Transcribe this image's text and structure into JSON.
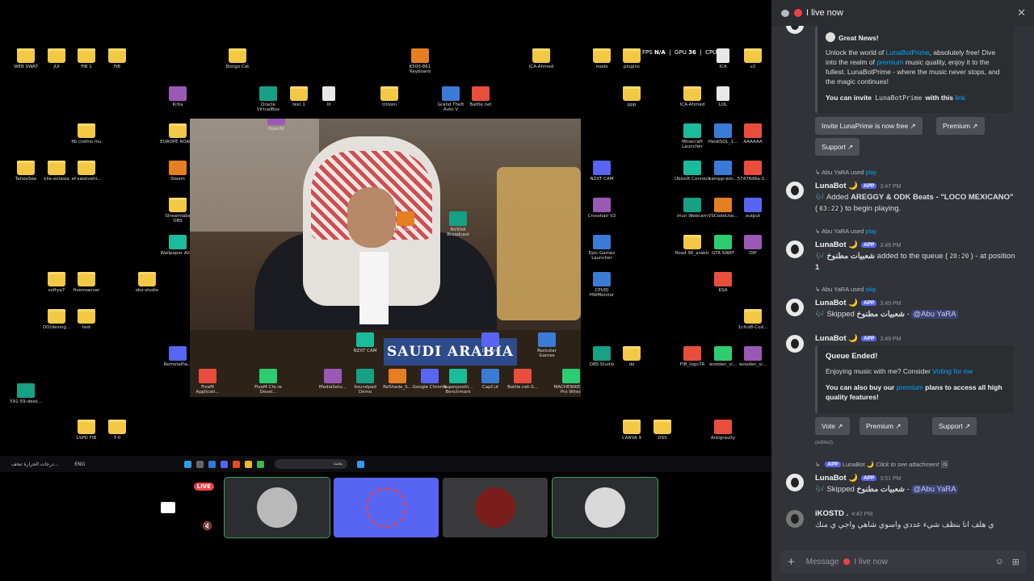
{
  "stream": {
    "overlay": {
      "fps": "FPS",
      "fps_value": "N/A",
      "gpu": "GPU",
      "gpu_value": "36",
      "cpu": "CPU"
    },
    "desktop_icons": [
      {
        "label": "WEB SWAT",
        "kind": "folder"
      },
      {
        "label": "JUI",
        "kind": "folder"
      },
      {
        "label": "FiB 1",
        "kind": "folder"
      },
      {
        "label": "FiB",
        "kind": "folder"
      },
      {
        "label": "Bongo Cat",
        "kind": "folder"
      },
      {
        "label": "K500-861 Keyboard",
        "kind": "app"
      },
      {
        "label": "ICA-Ahmed",
        "kind": "folder"
      },
      {
        "label": "mods",
        "kind": "folder"
      },
      {
        "label": "plugins",
        "kind": "folder"
      },
      {
        "label": "ICA",
        "kind": "file"
      },
      {
        "label": "v2",
        "kind": "folder"
      },
      {
        "label": "Krita",
        "kind": "app"
      },
      {
        "label": "Oracle VirtualBox",
        "kind": "app"
      },
      {
        "label": "test 1",
        "kind": "folder"
      },
      {
        "label": "lll",
        "kind": "file"
      },
      {
        "label": "citizen",
        "kind": "folder"
      },
      {
        "label": "Grand Theft Auto V",
        "kind": "app"
      },
      {
        "label": "Battle.net",
        "kind": "app"
      },
      {
        "label": "ppp",
        "kind": "folder"
      },
      {
        "label": "ICA-Ahmed",
        "kind": "folder"
      },
      {
        "label": "LOL",
        "kind": "file"
      },
      {
        "label": "fib clothis mu",
        "kind": "folder"
      },
      {
        "label": "EUROPE ROADS",
        "kind": "folder"
      },
      {
        "label": "Minecraft Launcher",
        "kind": "app"
      },
      {
        "label": "HeidiSQL_1...",
        "kind": "app"
      },
      {
        "label": "AAAAAA",
        "kind": "app"
      },
      {
        "label": "TahoeSee",
        "kind": "folder"
      },
      {
        "label": "kile-extesia",
        "kind": "folder"
      },
      {
        "label": "ef-swatvehi...",
        "kind": "folder"
      },
      {
        "label": "Steam",
        "kind": "app"
      },
      {
        "label": "NZXT CAM",
        "kind": "app"
      },
      {
        "label": "Ubisoft Connect",
        "kind": "app"
      },
      {
        "label": "xampp-win...",
        "kind": "app"
      },
      {
        "label": "57476d6a-3...",
        "kind": "app"
      },
      {
        "label": "Streamlabs OBS",
        "kind": "folder"
      },
      {
        "label": "Crosshair V2",
        "kind": "app"
      },
      {
        "label": "Iriun Webcam",
        "kind": "app"
      },
      {
        "label": "VSCodeUse...",
        "kind": "app"
      },
      {
        "label": "output",
        "kind": "app"
      },
      {
        "label": "Wallpaper Alive",
        "kind": "app"
      },
      {
        "label": "Epic Games Launcher",
        "kind": "app"
      },
      {
        "label": "Road 96_arabic",
        "kind": "folder"
      },
      {
        "label": "GTA SWAT",
        "kind": "app"
      },
      {
        "label": "OIP",
        "kind": "app"
      },
      {
        "label": "softyq7",
        "kind": "folder"
      },
      {
        "label": "fivemserver",
        "kind": "folder"
      },
      {
        "label": "obs-studio",
        "kind": "folder"
      },
      {
        "label": "Everything",
        "kind": "app"
      },
      {
        "label": "CPUID HWMonitor",
        "kind": "app"
      },
      {
        "label": "KSA",
        "kind": "app"
      },
      {
        "label": "DO(desing...",
        "kind": "folder"
      },
      {
        "label": "test",
        "kind": "folder"
      },
      {
        "label": "OBS Studio",
        "kind": "app"
      },
      {
        "label": "1cfcd8-Cod...",
        "kind": "folder"
      },
      {
        "label": "RemotePla...",
        "kind": "app"
      },
      {
        "label": "Brave",
        "kind": "app"
      },
      {
        "label": "do",
        "kind": "folder"
      },
      {
        "label": "FIB_logo7R",
        "kind": "app"
      },
      {
        "label": "wooden_si...",
        "kind": "app"
      },
      {
        "label": "wooden_si...",
        "kind": "app"
      },
      {
        "label": "591-59-desk...",
        "kind": "app"
      },
      {
        "label": "LSPD FIB",
        "kind": "folder"
      },
      {
        "label": "T-0",
        "kind": "folder"
      },
      {
        "label": "CANVA 9",
        "kind": "folder"
      },
      {
        "label": "DSS",
        "kind": "folder"
      },
      {
        "label": "Antigravity",
        "kind": "app"
      }
    ],
    "photo_icons": [
      {
        "label": "OpenIV"
      },
      {
        "label": "NVIDIA Broadcast"
      },
      {
        "label": "Riot Client"
      },
      {
        "label": "Discord"
      },
      {
        "label": "NZXT CAM"
      },
      {
        "label": "Rockstar Games"
      },
      {
        "label": "FiveM Applicati..."
      },
      {
        "label": "FiveM Cfx.re Devel..."
      },
      {
        "label": "MediaSetu..."
      },
      {
        "label": "Soundpad Demo"
      },
      {
        "label": "ReShade_S..."
      },
      {
        "label": "Google Chrome"
      },
      {
        "label": "Superpositi... Benchmark"
      },
      {
        "label": "CapCut"
      },
      {
        "label": "Battle.net-S..."
      },
      {
        "label": "MACHENIKE M7 Pro Wired"
      }
    ],
    "nameplate": "SAUDI ARABIA",
    "taskbar": {
      "lang": "ENG",
      "search_placeholder": "بحث",
      "weather": "درجات الحرارة تنخف..."
    },
    "live_badge": "LIVE"
  },
  "discord": {
    "channel": "I live now",
    "welcome_embed": {
      "title": "Great News!",
      "body1": "Unlock the world of ",
      "body_link1": "LunaBotPrime",
      "body2": ", absolutely free! Dive into the realm of ",
      "body_link2": "premium",
      "body3": " music quality, enjoy it to the fullest. LunaBotPrime - where the music never stops, and the magic continues!",
      "invite1": "You can invite ",
      "invite_code": "LunaBotPrime",
      "invite2": " with this ",
      "invite_link": "link"
    },
    "buttons1": [
      "Invite LunaPrime is now free",
      "Premium",
      "Support"
    ],
    "messages": [
      {
        "used_user": "Abu YaRA",
        "used_cmd": "play",
        "user": "LunaBot",
        "app": "APP",
        "time": "3:47 PM",
        "pre": "🎶 Added ",
        "song": "AREGGY & ODK Beats - \"LOCO MEXICANO\"",
        "mid": " (",
        "dur": "03:22",
        "post": ") to begin playing."
      },
      {
        "used_user": "Abu YaRA",
        "used_cmd": "play",
        "user": "LunaBot",
        "app": "APP",
        "time": "3:49 PM",
        "pre": "🎶 ",
        "song": "شعبيات مطنوخ",
        "mid": " added to the queue (",
        "dur": "20:20",
        "post": ") - at position ",
        "pos": "1"
      },
      {
        "used_user": "Abu YaRA",
        "used_cmd": "skip",
        "user": "LunaBot",
        "app": "APP",
        "time": "3:49 PM",
        "pre": "🎶 Skipped ",
        "song": "شعبيات مطنوخ",
        "post": " - ",
        "mention": "@Abu YaRA"
      },
      {
        "user": "LunaBot",
        "app": "APP",
        "time": "3:49 PM"
      }
    ],
    "queue_embed": {
      "title": "Queue Ended!",
      "body1": "Enjoying music with me? Consider ",
      "body_link": "Voting for me",
      "body2a": "You can also buy our ",
      "body2_link": "premium",
      "body2b": " plans to access all high quality features!"
    },
    "buttons2": [
      "Vote",
      "Premium",
      "Support"
    ],
    "edited": "(edited)",
    "attach_reply": {
      "app": "APP",
      "user": "LunaBot",
      "text": "Click to see attachment"
    },
    "msg5": {
      "user": "LunaBot",
      "app": "APP",
      "time": "3:51 PM",
      "pre": "🎶 Skipped ",
      "song": "شعبيات مطنوخ",
      "post": " - ",
      "mention": "@Abu YaRA"
    },
    "msg6": {
      "user": "iKOSTD .",
      "time": "4:42 PM",
      "text": "ي هلف انا بنظف شيء عددي واسوي شاهي واجي ي منك"
    },
    "input_placeholder": "Message",
    "input_channel": "I live now"
  }
}
